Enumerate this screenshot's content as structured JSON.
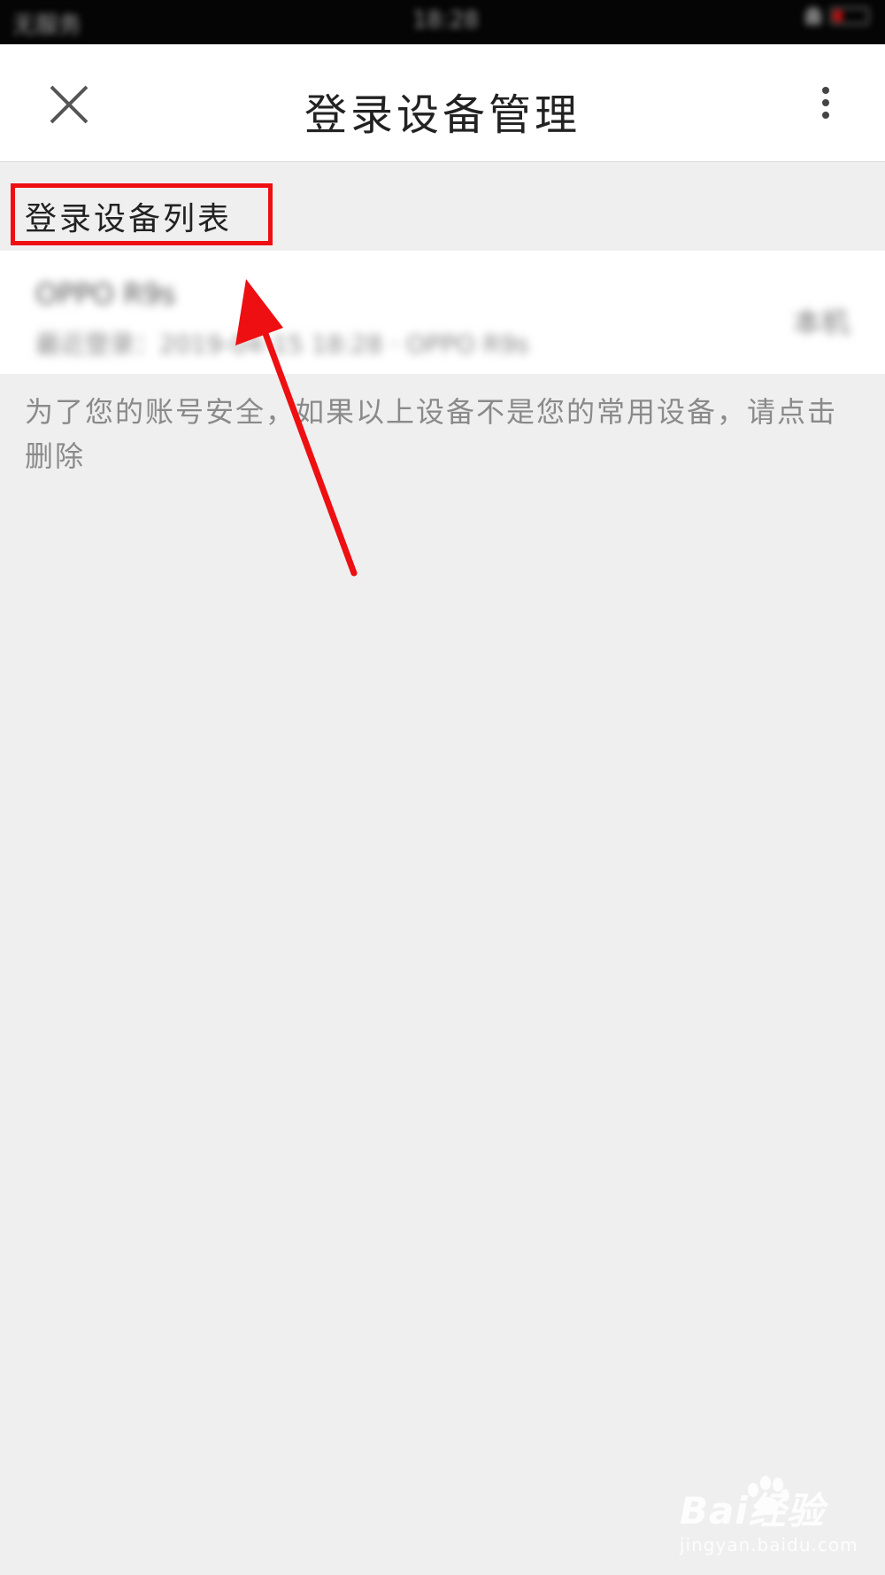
{
  "status_bar": {
    "carrier": "无服务",
    "time": "18:28"
  },
  "nav": {
    "title": "登录设备管理"
  },
  "section": {
    "label": "登录设备列表"
  },
  "device": {
    "name": "OPPO R9s",
    "detail": "最近登录：2019-04-15 18:28 · OPPO R9s",
    "status": "本机"
  },
  "notice": {
    "text": "为了您的账号安全，如果以上设备不是您的常用设备，请点击删除"
  },
  "watermark": {
    "brand": "Bai经验",
    "url": "jingyan.baidu.com"
  },
  "colors": {
    "highlight": "#ee0f12",
    "arrow": "#ee0f12"
  },
  "icons": [
    "close-icon",
    "more-vertical-icon",
    "battery-icon",
    "bell-icon"
  ]
}
